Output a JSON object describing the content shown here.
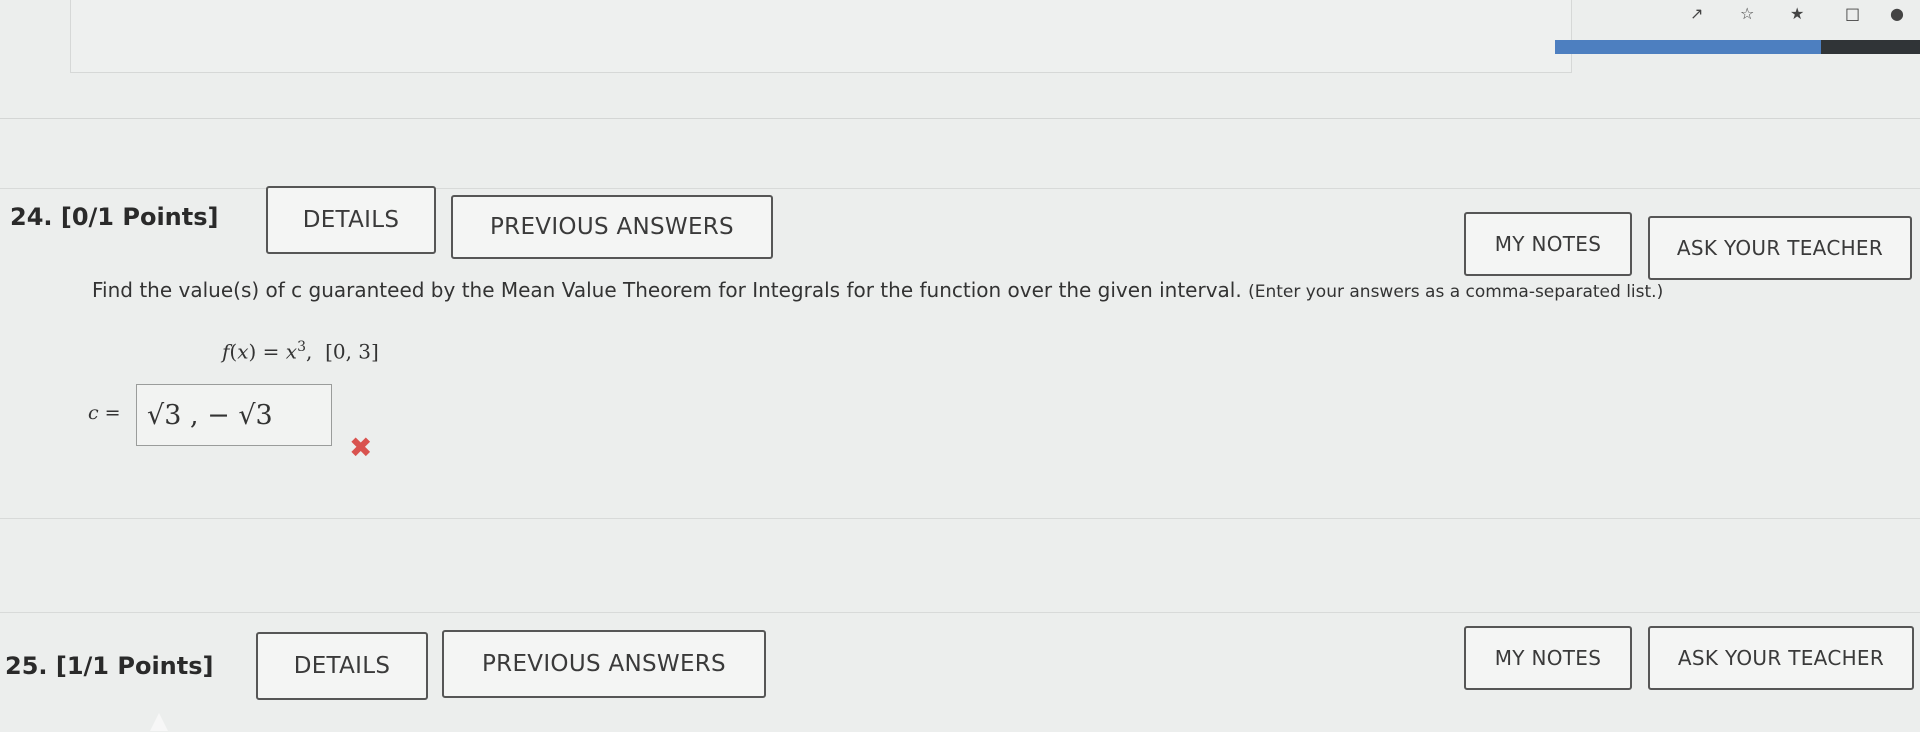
{
  "browser": {
    "icons": [
      "share-icon",
      "star-icon",
      "pin-icon",
      "window-icon",
      "profile-icon"
    ],
    "progress_fraction": 0.73,
    "accent_color": "#4d7fc0"
  },
  "q24": {
    "number": "24. [0/1 Points]",
    "details_label": "DETAILS",
    "previous_answers_label": "PREVIOUS ANSWERS",
    "my_notes_label": "MY NOTES",
    "ask_teacher_label": "ASK YOUR TEACHER",
    "prompt_main": "Find the value(s) of c guaranteed by the Mean Value Theorem for Integrals for the function over the given interval. ",
    "prompt_tail": "(Enter your answers as a comma-separated list.)",
    "function_text": "x",
    "function_exponent": "3",
    "interval_text": "[0, 3]",
    "answer_label": "c =",
    "answer_value": "√3 , − √3",
    "status": "incorrect",
    "status_color": "#d9534f"
  },
  "q25": {
    "number": "25. [1/1 Points]",
    "details_label": "DETAILS",
    "previous_answers_label": "PREVIOUS ANSWERS",
    "my_notes_label": "MY NOTES",
    "ask_teacher_label": "ASK YOUR TEACHER"
  }
}
